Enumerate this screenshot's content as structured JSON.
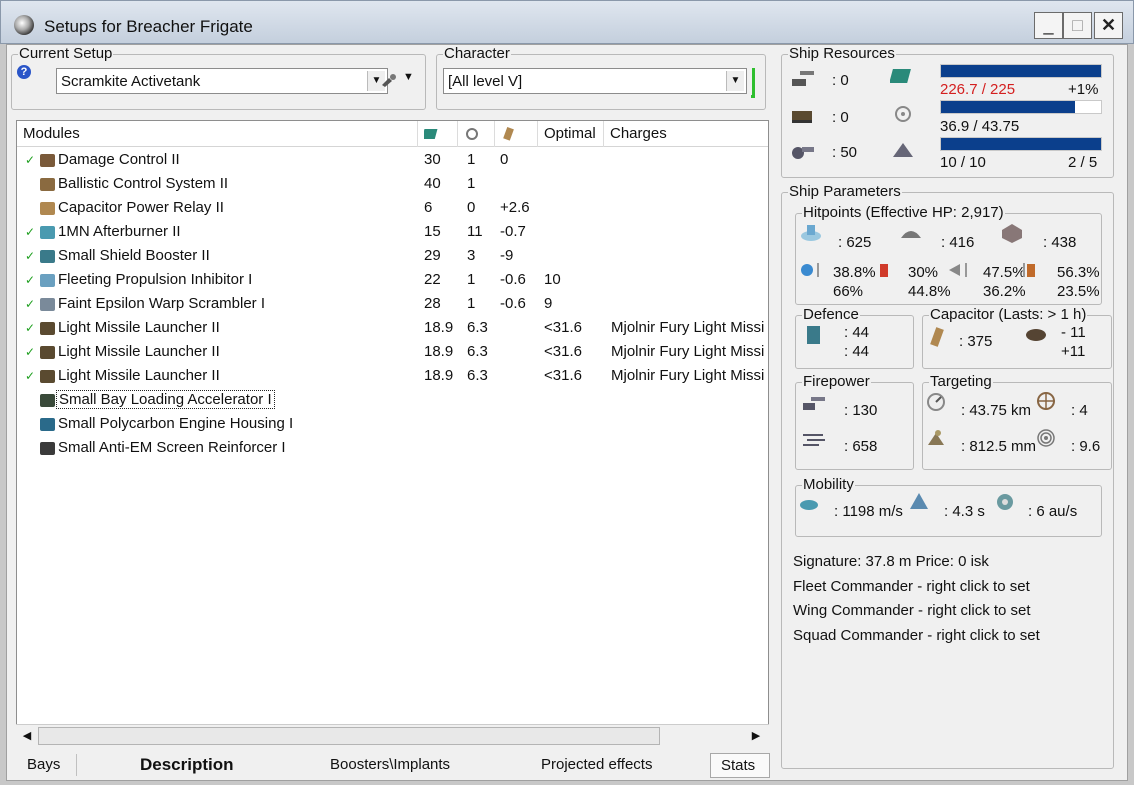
{
  "window": {
    "title": "Setups for Breacher Frigate",
    "minimize": "_",
    "maximize": "□",
    "close": "✕"
  },
  "setup": {
    "legend": "Current Setup",
    "value": "Scramkite Activetank",
    "help": "?"
  },
  "character": {
    "legend": "Character",
    "value": "[All level V]"
  },
  "modules_table": {
    "columns": [
      "Modules",
      "",
      "",
      "",
      "Optimal",
      "Charges"
    ],
    "rows": [
      {
        "check": "✓",
        "name": "Damage Control II",
        "cpu": "30",
        "pg": "1",
        "cap": "0",
        "optimal": "",
        "charges": "",
        "icon_color": "#7a5a3a"
      },
      {
        "check": "",
        "name": "Ballistic Control System II",
        "cpu": "40",
        "pg": "1",
        "cap": "",
        "optimal": "",
        "charges": "",
        "icon_color": "#8a6a40"
      },
      {
        "check": "",
        "name": "Capacitor Power Relay II",
        "cpu": "6",
        "pg": "0",
        "cap": "+2.6",
        "optimal": "",
        "charges": "",
        "icon_color": "#b08850"
      },
      {
        "check": "✓",
        "name": "1MN Afterburner II",
        "cpu": "15",
        "pg": "11",
        "cap": "-0.7",
        "optimal": "",
        "charges": "",
        "icon_color": "#4a9ab0"
      },
      {
        "check": "✓",
        "name": "Small Shield Booster II",
        "cpu": "29",
        "pg": "3",
        "cap": "-9",
        "optimal": "",
        "charges": "",
        "icon_color": "#3a7a8a"
      },
      {
        "check": "✓",
        "name": "Fleeting Propulsion Inhibitor I",
        "cpu": "22",
        "pg": "1",
        "cap": "-0.6",
        "optimal": "10",
        "charges": "",
        "icon_color": "#6aa0c0"
      },
      {
        "check": "✓",
        "name": "Faint Epsilon Warp Scrambler I",
        "cpu": "28",
        "pg": "1",
        "cap": "-0.6",
        "optimal": "9",
        "charges": "",
        "icon_color": "#7a8a9a"
      },
      {
        "check": "✓",
        "name": "Light Missile Launcher II",
        "cpu": "18.9",
        "pg": "6.3",
        "cap": "",
        "optimal": "<31.6",
        "charges": "Mjolnir Fury Light Missi",
        "icon_color": "#5a4a30"
      },
      {
        "check": "✓",
        "name": "Light Missile Launcher II",
        "cpu": "18.9",
        "pg": "6.3",
        "cap": "",
        "optimal": "<31.6",
        "charges": "Mjolnir Fury Light Missi",
        "icon_color": "#5a4a30"
      },
      {
        "check": "✓",
        "name": "Light Missile Launcher II",
        "cpu": "18.9",
        "pg": "6.3",
        "cap": "",
        "optimal": "<31.6",
        "charges": "Mjolnir Fury Light Missi",
        "icon_color": "#5a4a30"
      },
      {
        "check": "",
        "name": "Small Bay Loading Accelerator I",
        "cpu": "",
        "pg": "",
        "cap": "",
        "optimal": "",
        "charges": "",
        "icon_color": "#3a4a3a"
      },
      {
        "check": "",
        "name": "Small Polycarbon Engine Housing I",
        "cpu": "",
        "pg": "",
        "cap": "",
        "optimal": "",
        "charges": "",
        "icon_color": "#2a6a8a"
      },
      {
        "check": "",
        "name": "Small Anti-EM Screen Reinforcer I",
        "cpu": "",
        "pg": "",
        "cap": "",
        "optimal": "",
        "charges": "",
        "icon_color": "#3a3a3a"
      }
    ]
  },
  "scroll": {
    "left": "◀",
    "right": "▶"
  },
  "tabs": {
    "bays": "Bays",
    "description": "Description",
    "boosters": "Boosters\\Implants",
    "projected": "Projected effects",
    "stats": "Stats"
  },
  "resources": {
    "legend": "Ship Resources",
    "turret": ": 0",
    "launcher": ": 0",
    "calibration": ": 50",
    "cpu_text": "226.7 / 225",
    "cpu_pct": "+1%",
    "cpu_fill": 1.0,
    "pg_text": "36.9 / 43.75",
    "pg_fill": 0.84,
    "slots_text": "10 / 10",
    "drones_text": "2 / 5",
    "slots_fill": 1.0,
    "warn_color": "#d42020"
  },
  "parameters": {
    "legend": "Ship Parameters",
    "hitpoints": {
      "legend": "Hitpoints (Effective HP: 2,917)",
      "shield": ": 625",
      "armor": ": 416",
      "structure": ": 438",
      "r1a": "38.8%",
      "r1b": "66%",
      "r2a": "30%",
      "r2b": "44.8%",
      "r3a": "47.5%",
      "r3b": "36.2%",
      "r4a": "56.3%",
      "r4b": "23.5%"
    },
    "defence": {
      "legend": "Defence",
      "v1": ": 44",
      "v2": ": 44"
    },
    "capacitor": {
      "legend": "Capacitor (Lasts: > 1 h)",
      "amount": ": 375",
      "v1": "- 11",
      "v2": "+11"
    },
    "firepower": {
      "legend": "Firepower",
      "v1": ": 130",
      "v2": ": 658"
    },
    "targeting": {
      "legend": "Targeting",
      "range": ": 43.75 km",
      "targets": ": 4",
      "scanres": ": 812.5 mm",
      "sensor": ": 9.6"
    },
    "mobility": {
      "legend": "Mobility",
      "speed": ": 1198 m/s",
      "align": ": 4.3 s",
      "warp": ": 6 au/s"
    },
    "signature": "Signature: 37.8 m   Price: 0 isk",
    "fleet": "Fleet Commander - right click to set",
    "wing": "Wing Commander - right click to set",
    "squad": "Squad Commander - right click to set"
  }
}
